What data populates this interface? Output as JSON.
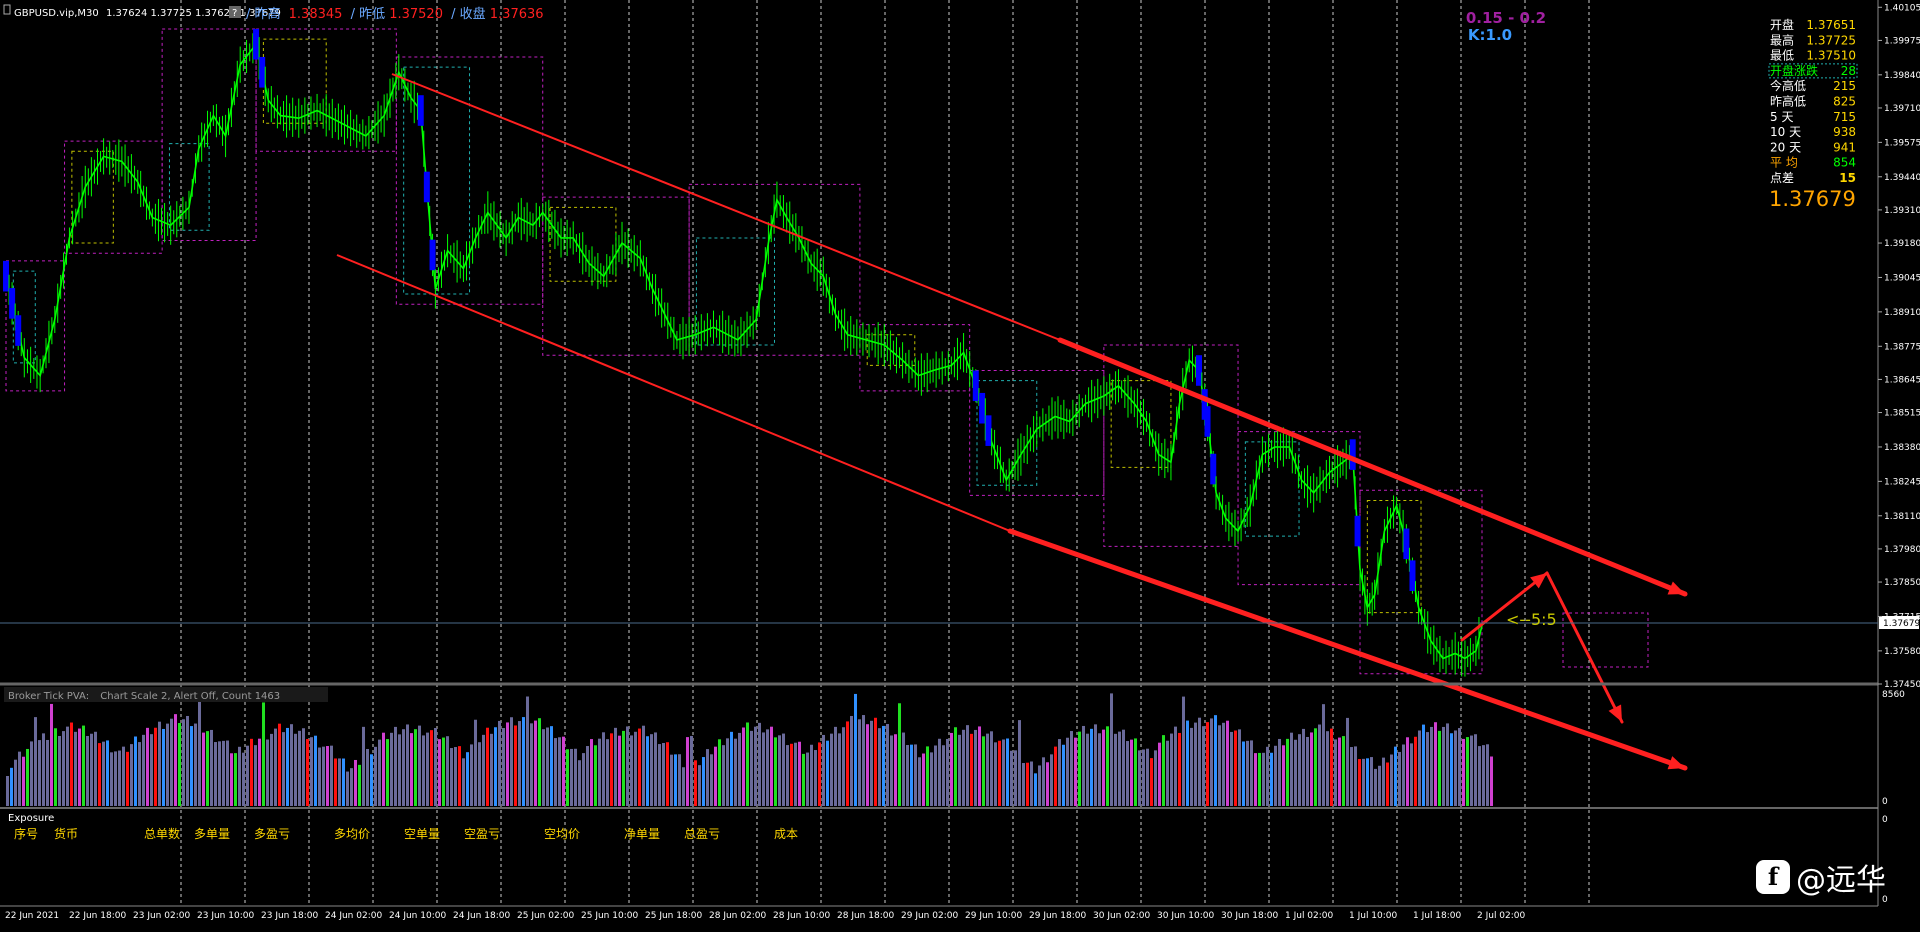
{
  "colors": {
    "background": "#000000",
    "bull": "#00ff00",
    "bear_fill": "#0000ff",
    "trendline": "#ff2020",
    "grid": "#cccccc",
    "box_magenta": "#c020c0",
    "box_cyan": "#20b0b0",
    "box_yellow": "#c0c000",
    "price_line": "#4a6a8a",
    "info_label_orange": "#ffa500",
    "info_label_white": "#ffffff",
    "info_value_yellow": "#ffd700",
    "info_value_green": "#00ff00",
    "vol_grey": "#6a6a9a",
    "vol_red": "#ff1010",
    "vol_green": "#20e020",
    "vol_blue": "#3090ff",
    "vol_magenta": "#d040d0"
  },
  "header": {
    "symbol": "GBPUSD.vip,M30",
    "ohlc": "1.37624 1.37725 1.37621 1.37679",
    "prev_high_label": "/ 昨高",
    "prev_high_value": "1.38345",
    "prev_low_label": "/ 昨低",
    "prev_low_value": "1.37520",
    "close_label": "/ 收盘",
    "close_value": "1.37636"
  },
  "ratio_label": "0.15 - 0.2",
  "k_label": "K:1.0",
  "info_panel": {
    "rows": [
      {
        "label": "开盘",
        "value": "1.37651"
      },
      {
        "label": "最高",
        "value": "1.37725"
      },
      {
        "label": "最低",
        "value": "1.37510"
      },
      {
        "label": "开盘涨跌",
        "value": "28"
      },
      {
        "label": "今高低",
        "value": "215"
      },
      {
        "label": "昨高低",
        "value": "825"
      },
      {
        "label": "5 天",
        "value": "715"
      },
      {
        "label": "10 天",
        "value": "938"
      },
      {
        "label": "20 天",
        "value": "941"
      },
      {
        "label": "平 均",
        "value": "854"
      },
      {
        "label": "点差",
        "value": "15"
      }
    ],
    "big_price": "1.37679"
  },
  "annotation": "<--5:5",
  "current_price_tag": "1.37679",
  "volume_panel": {
    "title": "Broker Tick PVA:",
    "settings": "Chart Scale  2,  Alert Off,  Count  1463",
    "axis_top": "8560",
    "axis_bottom": "0"
  },
  "exposure_panel": {
    "title": "Exposure",
    "headers": [
      "序号",
      "货币",
      "总单数",
      "多单量",
      "多盈亏",
      "多均价",
      "空单量",
      "空盈亏",
      "空均价",
      "净单量",
      "总盈亏",
      "成本"
    ],
    "axis_top": "0",
    "axis_bottom": "0"
  },
  "watermark": "@远华",
  "chart_data": {
    "type": "line",
    "symbol": "GBPUSD.vip",
    "timeframe": "M30",
    "price_axis_ticks": [
      "1.40105",
      "1.39975",
      "1.39840",
      "1.39710",
      "1.39575",
      "1.39440",
      "1.39310",
      "1.39180",
      "1.39045",
      "1.38910",
      "1.38775",
      "1.38645",
      "1.38515",
      "1.38380",
      "1.38245",
      "1.38110",
      "1.37980",
      "1.37850",
      "1.37715",
      "1.37580",
      "1.37450"
    ],
    "time_axis_ticks": [
      "22 Jun 2021",
      "22 Jun 18:00",
      "23 Jun 02:00",
      "23 Jun 10:00",
      "23 Jun 18:00",
      "24 Jun 02:00",
      "24 Jun 10:00",
      "24 Jun 18:00",
      "25 Jun 02:00",
      "25 Jun 10:00",
      "25 Jun 18:00",
      "28 Jun 02:00",
      "28 Jun 10:00",
      "28 Jun 18:00",
      "29 Jun 02:00",
      "29 Jun 10:00",
      "29 Jun 18:00",
      "30 Jun 02:00",
      "30 Jun 10:00",
      "30 Jun 18:00",
      "1 Jul 02:00",
      "1 Jul 10:00",
      "1 Jul 18:00",
      "2 Jul 02:00"
    ],
    "ylim": [
      1.3745,
      1.4011
    ],
    "x_range": [
      0,
      1210
    ],
    "grid": true,
    "price_path": [
      [
        0,
        1.3905
      ],
      [
        15,
        1.3873
      ],
      [
        28,
        1.3866
      ],
      [
        40,
        1.3888
      ],
      [
        52,
        1.392
      ],
      [
        65,
        1.394
      ],
      [
        80,
        1.3952
      ],
      [
        95,
        1.395
      ],
      [
        108,
        1.3942
      ],
      [
        120,
        1.3928
      ],
      [
        135,
        1.3925
      ],
      [
        150,
        1.3932
      ],
      [
        158,
        1.3955
      ],
      [
        170,
        1.3968
      ],
      [
        180,
        1.396
      ],
      [
        192,
        1.3988
      ],
      [
        205,
        1.3996
      ],
      [
        215,
        1.3974
      ],
      [
        225,
        1.3968
      ],
      [
        240,
        1.3967
      ],
      [
        255,
        1.397
      ],
      [
        275,
        1.3965
      ],
      [
        295,
        1.396
      ],
      [
        310,
        1.3968
      ],
      [
        322,
        1.3985
      ],
      [
        332,
        1.3975
      ],
      [
        340,
        1.397
      ],
      [
        345,
        1.394
      ],
      [
        352,
        1.39
      ],
      [
        362,
        1.3915
      ],
      [
        375,
        1.3908
      ],
      [
        385,
        1.392
      ],
      [
        395,
        1.393
      ],
      [
        410,
        1.392
      ],
      [
        420,
        1.3928
      ],
      [
        432,
        1.3925
      ],
      [
        440,
        1.393
      ],
      [
        455,
        1.392
      ],
      [
        465,
        1.392
      ],
      [
        478,
        1.391
      ],
      [
        490,
        1.3905
      ],
      [
        505,
        1.3918
      ],
      [
        520,
        1.3912
      ],
      [
        530,
        1.39
      ],
      [
        540,
        1.389
      ],
      [
        550,
        1.388
      ],
      [
        565,
        1.3882
      ],
      [
        580,
        1.3885
      ],
      [
        600,
        1.388
      ],
      [
        615,
        1.3888
      ],
      [
        625,
        1.3918
      ],
      [
        632,
        1.3935
      ],
      [
        640,
        1.3928
      ],
      [
        650,
        1.392
      ],
      [
        660,
        1.391
      ],
      [
        670,
        1.3905
      ],
      [
        680,
        1.389
      ],
      [
        690,
        1.3882
      ],
      [
        705,
        1.388
      ],
      [
        720,
        1.3878
      ],
      [
        735,
        1.3872
      ],
      [
        748,
        1.3866
      ],
      [
        760,
        1.3868
      ],
      [
        775,
        1.387
      ],
      [
        785,
        1.3875
      ],
      [
        795,
        1.3862
      ],
      [
        808,
        1.384
      ],
      [
        820,
        1.3825
      ],
      [
        832,
        1.3835
      ],
      [
        845,
        1.3845
      ],
      [
        860,
        1.385
      ],
      [
        872,
        1.3848
      ],
      [
        885,
        1.3855
      ],
      [
        900,
        1.3858
      ],
      [
        912,
        1.3862
      ],
      [
        925,
        1.3855
      ],
      [
        935,
        1.3848
      ],
      [
        945,
        1.3835
      ],
      [
        955,
        1.3832
      ],
      [
        962,
        1.3855
      ],
      [
        970,
        1.3872
      ],
      [
        978,
        1.3868
      ],
      [
        985,
        1.3848
      ],
      [
        992,
        1.382
      ],
      [
        1000,
        1.381
      ],
      [
        1010,
        1.3805
      ],
      [
        1020,
        1.3815
      ],
      [
        1030,
        1.3835
      ],
      [
        1040,
        1.3838
      ],
      [
        1052,
        1.3838
      ],
      [
        1062,
        1.3825
      ],
      [
        1072,
        1.382
      ],
      [
        1085,
        1.3828
      ],
      [
        1096,
        1.3832
      ],
      [
        1104,
        1.3835
      ],
      [
        1110,
        1.379
      ],
      [
        1116,
        1.3775
      ],
      [
        1122,
        1.378
      ],
      [
        1130,
        1.3805
      ],
      [
        1140,
        1.3815
      ],
      [
        1148,
        1.38
      ],
      [
        1158,
        1.3775
      ],
      [
        1168,
        1.3762
      ],
      [
        1178,
        1.3755
      ],
      [
        1188,
        1.3757
      ],
      [
        1196,
        1.3755
      ],
      [
        1205,
        1.3758
      ],
      [
        1210,
        1.3768
      ]
    ]
  }
}
